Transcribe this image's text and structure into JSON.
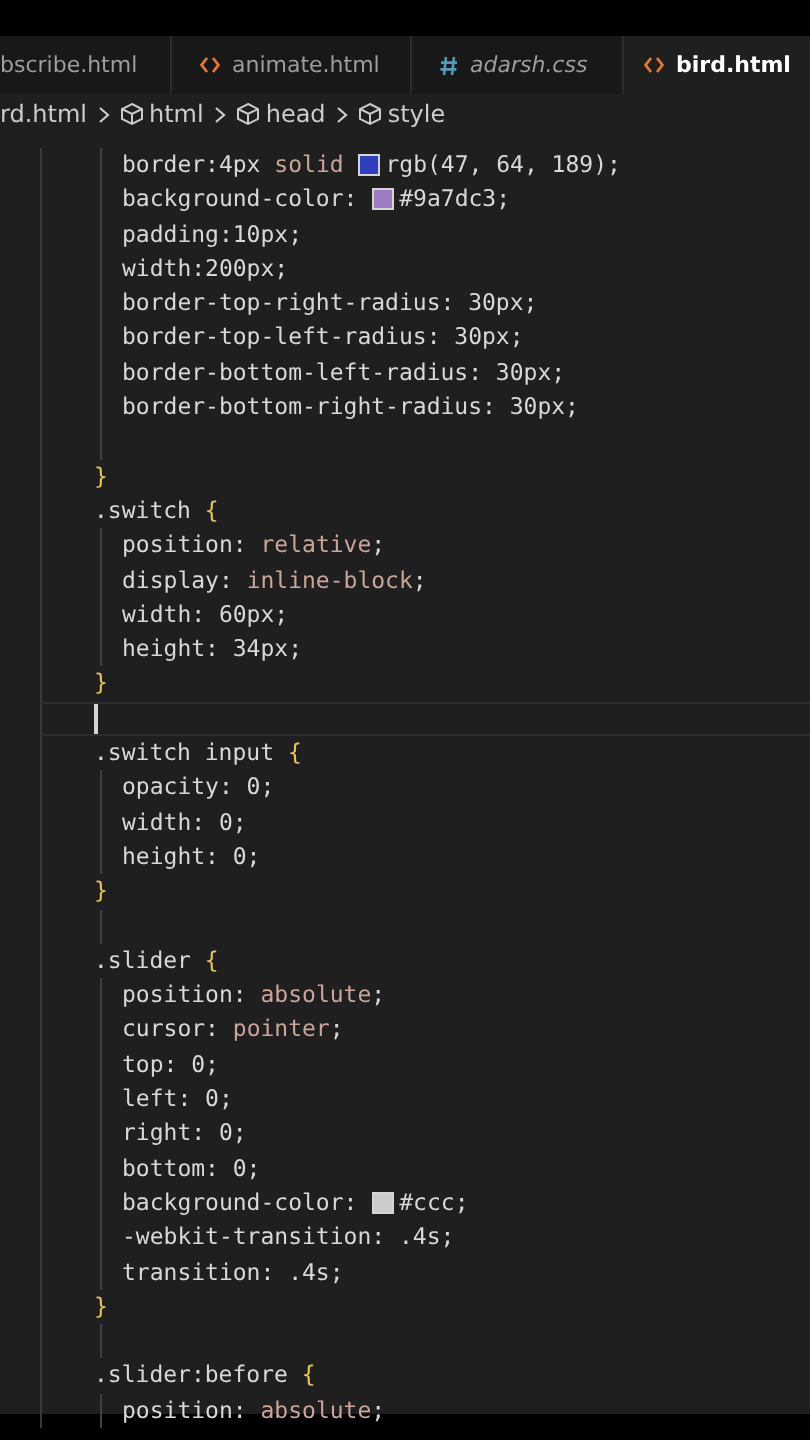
{
  "tabs": [
    {
      "label": "bscribe.html",
      "kind": "none",
      "italic": false,
      "selected": false
    },
    {
      "label": "animate.html",
      "kind": "html",
      "italic": false,
      "selected": false
    },
    {
      "label": "adarsh.css",
      "kind": "css",
      "italic": true,
      "selected": false
    },
    {
      "label": "bird.html",
      "kind": "html",
      "italic": false,
      "selected": true
    }
  ],
  "breadcrumb": [
    {
      "label": "rd.html",
      "kind": "file"
    },
    {
      "label": "html",
      "kind": "element"
    },
    {
      "label": "head",
      "kind": "element"
    },
    {
      "label": "style",
      "kind": "element"
    }
  ],
  "code_lines": [
    {
      "kind": "declaration",
      "cursor": false,
      "segments": [
        {
          "text": "border:4px ",
          "kind": "prop"
        },
        {
          "text": "solid ",
          "kind": "value"
        },
        {
          "kind": "swatch",
          "color": "#2f40bd"
        },
        {
          "text": "rgb(47, 64, 189);",
          "kind": "prop"
        }
      ]
    },
    {
      "kind": "declaration",
      "cursor": false,
      "segments": [
        {
          "text": "background-color: ",
          "kind": "prop"
        },
        {
          "kind": "swatch",
          "color": "#9a7dc3"
        },
        {
          "text": "#9a7dc3;",
          "kind": "prop"
        }
      ]
    },
    {
      "kind": "declaration",
      "cursor": false,
      "segments": [
        {
          "text": "padding:10px;",
          "kind": "prop"
        }
      ]
    },
    {
      "kind": "declaration",
      "cursor": false,
      "segments": [
        {
          "text": "width:200px;",
          "kind": "prop"
        }
      ]
    },
    {
      "kind": "declaration",
      "cursor": false,
      "segments": [
        {
          "text": "border-top-right-radius: 30px;",
          "kind": "prop"
        }
      ]
    },
    {
      "kind": "declaration",
      "cursor": false,
      "segments": [
        {
          "text": "border-top-left-radius: 30px;",
          "kind": "prop"
        }
      ]
    },
    {
      "kind": "declaration",
      "cursor": false,
      "segments": [
        {
          "text": "border-bottom-left-radius: 30px;",
          "kind": "prop"
        }
      ]
    },
    {
      "kind": "declaration",
      "cursor": false,
      "segments": [
        {
          "text": "border-bottom-right-radius: 30px;",
          "kind": "prop"
        }
      ]
    },
    {
      "kind": "blank",
      "cursor": false
    },
    {
      "kind": "close",
      "cursor": false,
      "segments": [
        {
          "text": "}",
          "kind": "brace"
        }
      ]
    },
    {
      "kind": "selector",
      "cursor": false,
      "segments": [
        {
          "text": ".switch ",
          "kind": "prop"
        },
        {
          "text": "{",
          "kind": "brace"
        }
      ]
    },
    {
      "kind": "declaration",
      "cursor": false,
      "segments": [
        {
          "text": "position: ",
          "kind": "prop"
        },
        {
          "text": "relative",
          "kind": "value"
        },
        {
          "text": ";",
          "kind": "prop"
        }
      ]
    },
    {
      "kind": "declaration",
      "cursor": false,
      "segments": [
        {
          "text": "display: ",
          "kind": "prop"
        },
        {
          "text": "inline-block",
          "kind": "value"
        },
        {
          "text": ";",
          "kind": "prop"
        }
      ]
    },
    {
      "kind": "declaration",
      "cursor": false,
      "segments": [
        {
          "text": "width: 60px;",
          "kind": "prop"
        }
      ]
    },
    {
      "kind": "declaration",
      "cursor": false,
      "segments": [
        {
          "text": "height: 34px;",
          "kind": "prop"
        }
      ]
    },
    {
      "kind": "close",
      "cursor": false,
      "segments": [
        {
          "text": "}",
          "kind": "brace"
        }
      ]
    },
    {
      "kind": "blank",
      "cursor": true
    },
    {
      "kind": "selector",
      "cursor": false,
      "segments": [
        {
          "text": ".switch input ",
          "kind": "prop"
        },
        {
          "text": "{",
          "kind": "brace"
        }
      ]
    },
    {
      "kind": "declaration",
      "cursor": false,
      "segments": [
        {
          "text": "opacity: 0;",
          "kind": "prop"
        }
      ]
    },
    {
      "kind": "declaration",
      "cursor": false,
      "segments": [
        {
          "text": "width: 0;",
          "kind": "prop"
        }
      ]
    },
    {
      "kind": "declaration",
      "cursor": false,
      "segments": [
        {
          "text": "height: 0;",
          "kind": "prop"
        }
      ]
    },
    {
      "kind": "close",
      "cursor": false,
      "segments": [
        {
          "text": "}",
          "kind": "brace"
        }
      ]
    },
    {
      "kind": "blank",
      "cursor": false
    },
    {
      "kind": "selector",
      "cursor": false,
      "segments": [
        {
          "text": ".slider ",
          "kind": "prop"
        },
        {
          "text": "{",
          "kind": "brace"
        }
      ]
    },
    {
      "kind": "declaration",
      "cursor": false,
      "segments": [
        {
          "text": "position: ",
          "kind": "prop"
        },
        {
          "text": "absolute",
          "kind": "value"
        },
        {
          "text": ";",
          "kind": "prop"
        }
      ]
    },
    {
      "kind": "declaration",
      "cursor": false,
      "segments": [
        {
          "text": "cursor: ",
          "kind": "prop"
        },
        {
          "text": "pointer",
          "kind": "value"
        },
        {
          "text": ";",
          "kind": "prop"
        }
      ]
    },
    {
      "kind": "declaration",
      "cursor": false,
      "segments": [
        {
          "text": "top: 0;",
          "kind": "prop"
        }
      ]
    },
    {
      "kind": "declaration",
      "cursor": false,
      "segments": [
        {
          "text": "left: 0;",
          "kind": "prop"
        }
      ]
    },
    {
      "kind": "declaration",
      "cursor": false,
      "segments": [
        {
          "text": "right: 0;",
          "kind": "prop"
        }
      ]
    },
    {
      "kind": "declaration",
      "cursor": false,
      "segments": [
        {
          "text": "bottom: 0;",
          "kind": "prop"
        }
      ]
    },
    {
      "kind": "declaration",
      "cursor": false,
      "segments": [
        {
          "text": "background-color: ",
          "kind": "prop"
        },
        {
          "kind": "swatch",
          "color": "#cccccc"
        },
        {
          "text": "#ccc;",
          "kind": "prop"
        }
      ]
    },
    {
      "kind": "declaration",
      "cursor": false,
      "segments": [
        {
          "text": "-webkit-transition: .4s;",
          "kind": "prop"
        }
      ]
    },
    {
      "kind": "declaration",
      "cursor": false,
      "segments": [
        {
          "text": "transition: .4s;",
          "kind": "prop"
        }
      ]
    },
    {
      "kind": "close",
      "cursor": false,
      "segments": [
        {
          "text": "}",
          "kind": "brace"
        }
      ]
    },
    {
      "kind": "blank",
      "cursor": false
    },
    {
      "kind": "selector",
      "cursor": false,
      "segments": [
        {
          "text": ".slider:before ",
          "kind": "prop"
        },
        {
          "text": "{",
          "kind": "brace"
        }
      ]
    },
    {
      "kind": "declaration",
      "cursor": false,
      "segments": [
        {
          "text": "position: ",
          "kind": "prop"
        },
        {
          "text": "absolute",
          "kind": "value"
        },
        {
          "text": ";",
          "kind": "prop"
        }
      ]
    }
  ]
}
